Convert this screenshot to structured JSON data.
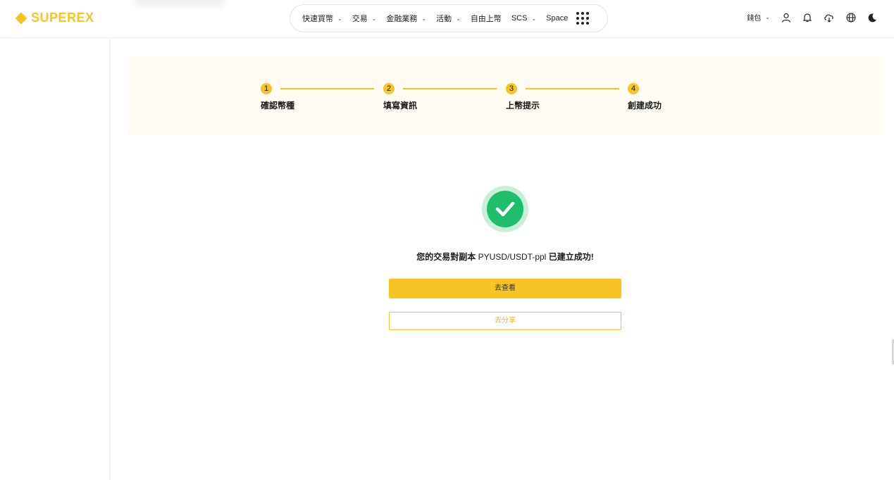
{
  "brand": {
    "name": "SUPEREX",
    "color": "#f7c325"
  },
  "nav": {
    "items": [
      {
        "label": "快速買幣",
        "dropdown": true
      },
      {
        "label": "交易",
        "dropdown": true
      },
      {
        "label": "金融業務",
        "dropdown": true
      },
      {
        "label": "活動",
        "dropdown": true
      },
      {
        "label": "自由上幣",
        "dropdown": false
      },
      {
        "label": "SCS",
        "dropdown": true
      },
      {
        "label": "Space",
        "dropdown": false
      }
    ],
    "apps_icon": "grid-dots-icon"
  },
  "tools": {
    "wallet_label": "錢包",
    "icons": [
      "user-icon",
      "bell-icon",
      "cloud-download-icon",
      "globe-icon",
      "moon-icon"
    ]
  },
  "steps": [
    {
      "number": "1",
      "label": "確認幣種"
    },
    {
      "number": "2",
      "label": "填寫資訊"
    },
    {
      "number": "3",
      "label": "上幣提示"
    },
    {
      "number": "4",
      "label": "創建成功"
    }
  ],
  "result": {
    "prefix": "您的交易對副本",
    "pair": "PYUSD/USDT-ppl",
    "suffix": "已建立成功!",
    "status_color": "#1fbe6d"
  },
  "actions": {
    "view_label": "去查看",
    "share_label": "去分享"
  }
}
